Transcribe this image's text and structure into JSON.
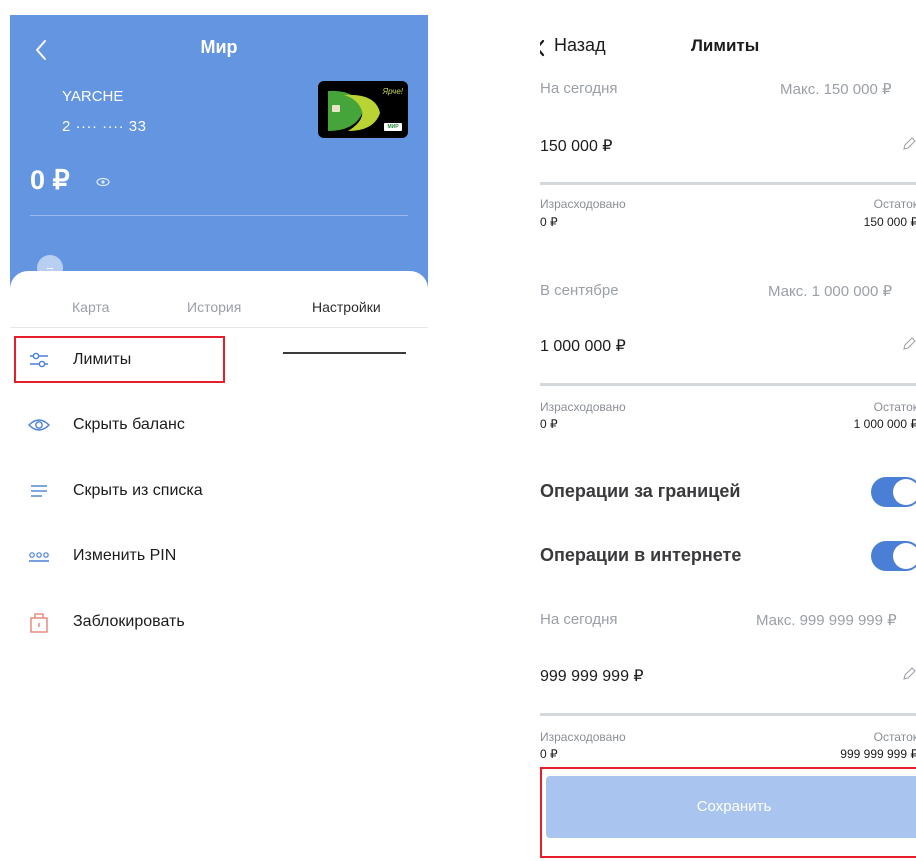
{
  "left_screen": {
    "header": {
      "title": "Мир",
      "card_name": "YARCHE",
      "card_number": "2 ···· ···· 33",
      "card_brand_text": "Ярче!",
      "card_network": "МИР",
      "balance": "0 ₽",
      "accent_color": "#6495e0"
    },
    "tabs": [
      {
        "label": "Карта",
        "active": false
      },
      {
        "label": "История",
        "active": false
      },
      {
        "label": "Настройки",
        "active": true
      }
    ],
    "menu": [
      {
        "label": "Лимиты",
        "icon": "sliders-icon",
        "highlighted": true
      },
      {
        "label": "Скрыть баланс",
        "icon": "eye-icon"
      },
      {
        "label": "Скрыть из списка",
        "icon": "list-icon"
      },
      {
        "label": "Изменить PIN",
        "icon": "pin-dots-icon"
      },
      {
        "label": "Заблокировать",
        "icon": "lock-icon"
      }
    ]
  },
  "right_screen": {
    "nav": {
      "back_label": "Назад",
      "title": "Лимиты"
    },
    "limit_today": {
      "label": "На сегодня",
      "max": "Макс. 150 000 ₽",
      "value": "150 000 ₽",
      "spent_label": "Израсходовано",
      "spent_value": "0 ₽",
      "remaining_label": "Остаток",
      "remaining_value": "150 000 ₽"
    },
    "limit_month": {
      "label": "В сентябре",
      "max": "Макс. 1 000 000 ₽",
      "value": "1 000 000 ₽",
      "spent_label": "Израсходовано",
      "spent_value": "0 ₽",
      "remaining_label": "Остаток",
      "remaining_value": "1 000 000 ₽"
    },
    "toggles": [
      {
        "label": "Операции за границей",
        "on": true
      },
      {
        "label": "Операции в интернете",
        "on": true
      }
    ],
    "limit_internet": {
      "label": "На сегодня",
      "max": "Макс. 999 999 999 ₽",
      "value": "999 999 999 ₽",
      "spent_label": "Израсходовано",
      "spent_value": "0 ₽",
      "remaining_label": "Остаток",
      "remaining_value": "999 999 999 ₽"
    },
    "save_button": "Сохранить",
    "highlight_color": "#e5202c"
  }
}
